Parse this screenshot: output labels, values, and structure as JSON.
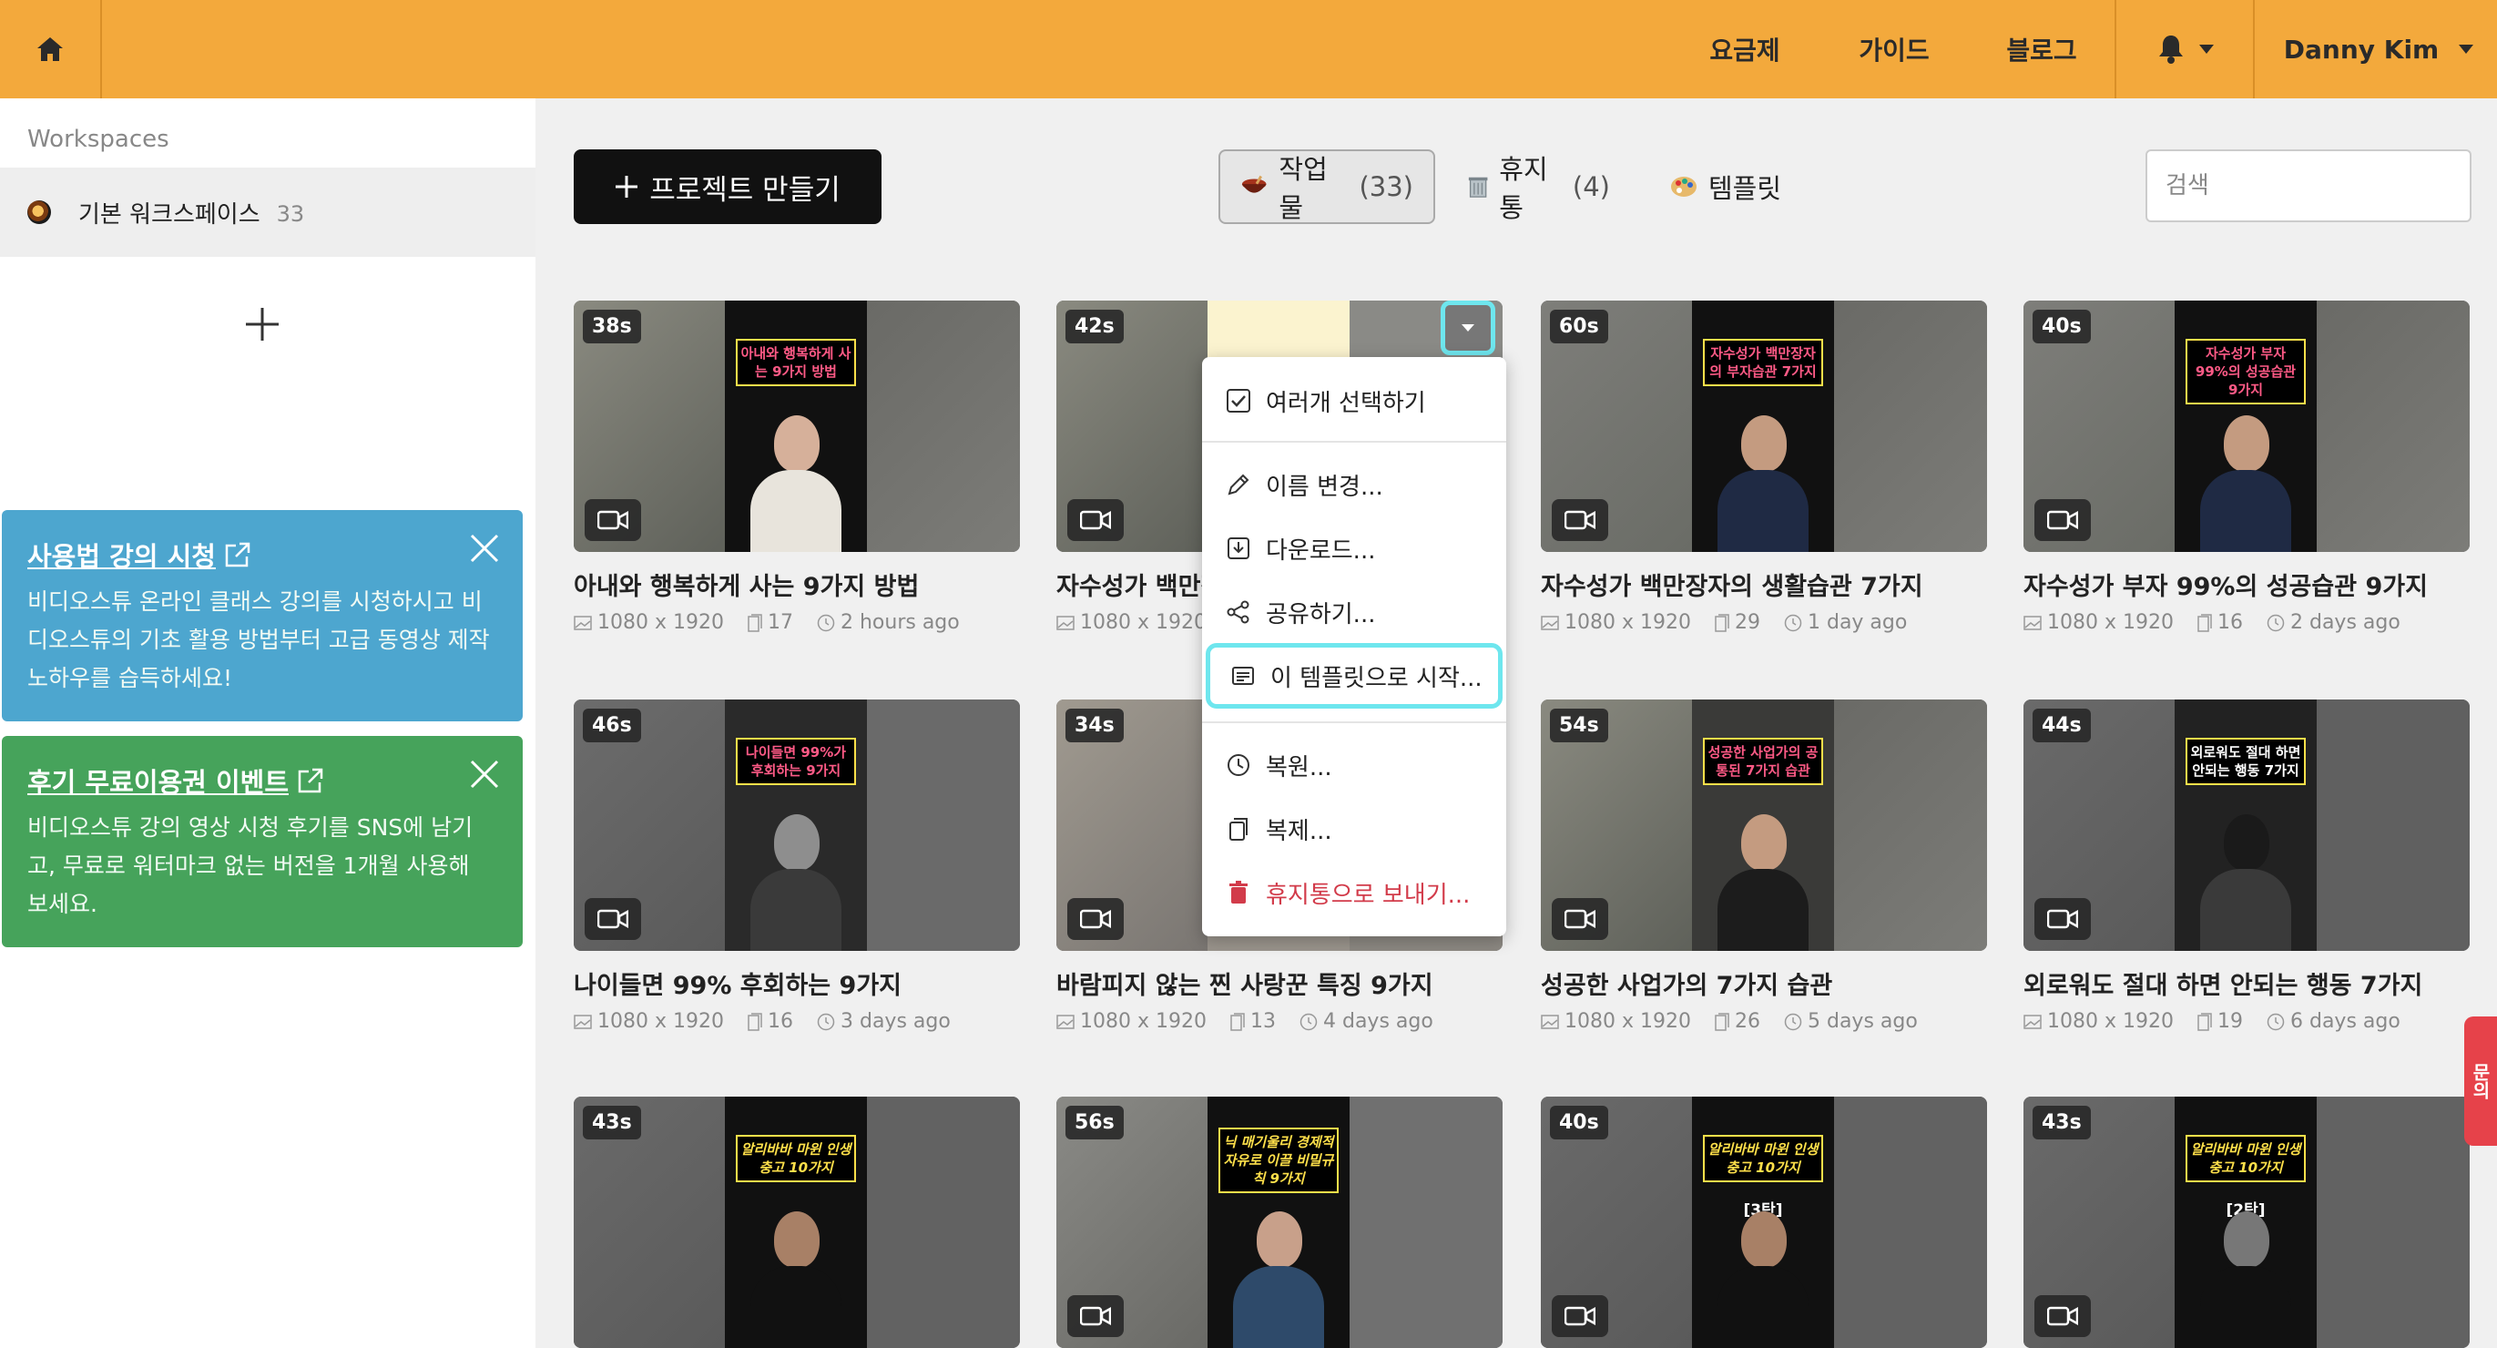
{
  "topbar": {
    "nav": [
      "요금제",
      "가이드",
      "블로그"
    ],
    "user": "Danny Kim"
  },
  "sidebar": {
    "header": "Workspaces",
    "workspace": {
      "name": "기본 워크스페이스",
      "count": "33"
    },
    "promos": [
      {
        "title": "사용법 강의 시청",
        "body": "비디오스튜 온라인 클래스 강의를 시청하시고 비디오스튜의 기초 활용 방법부터 고급 동영상 제작 노하우를 습득하세요!"
      },
      {
        "title": "후기 무료이용권 이벤트",
        "body": "비디오스튜 강의 영상 시청 후기를 SNS에 남기고, 무료로 워터마크 없는 버전을 1개월 사용해 보세요."
      }
    ]
  },
  "toolbar": {
    "create_label": "프로젝트 만들기",
    "tabs": [
      {
        "label": "작업물",
        "count": "(33)"
      },
      {
        "label": "휴지통",
        "count": "(4)"
      },
      {
        "label": "템플릿",
        "count": ""
      }
    ],
    "search_placeholder": "검색"
  },
  "cards": [
    {
      "duration": "38s",
      "title": "아내와 행복하게 사는 9가지 방법",
      "resolution": "1080 x 1920",
      "pages": "17",
      "time": "2 hours ago",
      "poster": "아내와 행복하게 사는 9가지 방법"
    },
    {
      "duration": "42s",
      "title": "자수성가 백만장자의 생활습관",
      "resolution": "1080 x 1920",
      "pages": "",
      "time": "",
      "poster": ""
    },
    {
      "duration": "60s",
      "title": "자수성가 백만장자의 생활습관 7가지",
      "resolution": "1080 x 1920",
      "pages": "29",
      "time": "1 day ago",
      "poster": "자수성가 백만장자의 부자습관 7가지"
    },
    {
      "duration": "40s",
      "title": "자수성가 부자 99%의 성공습관 9가지",
      "resolution": "1080 x 1920",
      "pages": "16",
      "time": "2 days ago",
      "poster": "자수성가 부자 99%의 성공습관 9가지"
    },
    {
      "duration": "46s",
      "title": "나이들면 99% 후회하는 9가지",
      "resolution": "1080 x 1920",
      "pages": "16",
      "time": "3 days ago",
      "poster": "나이들면 99%가 후회하는 9가지"
    },
    {
      "duration": "34s",
      "title": "바람피지 않는 찐 사랑꾼 특징 9가지",
      "resolution": "1080 x 1920",
      "pages": "13",
      "time": "4 days ago",
      "poster": ""
    },
    {
      "duration": "54s",
      "title": "성공한 사업가의 7가지 습관",
      "resolution": "1080 x 1920",
      "pages": "26",
      "time": "5 days ago",
      "poster": "성공한 사업가의 공통된 7가지 습관"
    },
    {
      "duration": "44s",
      "title": "외로워도 절대 하면 안되는 행동 7가지",
      "resolution": "1080 x 1920",
      "pages": "19",
      "time": "6 days ago",
      "poster": "외로워도 절대 하면 안되는 행동 7가지"
    },
    {
      "duration": "43s",
      "title": "",
      "resolution": "",
      "pages": "",
      "time": "",
      "poster": "알리바바 마윈 인생충고 10가지"
    },
    {
      "duration": "56s",
      "title": "",
      "resolution": "",
      "pages": "",
      "time": "",
      "poster": "닉 매기울리 경제적자유로 이끌 비밀규칙 9가지"
    },
    {
      "duration": "40s",
      "title": "",
      "resolution": "",
      "pages": "",
      "time": "",
      "poster": "알리바바 마윈 인생충고 10가지",
      "poster_sub": "[3탄]"
    },
    {
      "duration": "43s",
      "title": "",
      "resolution": "",
      "pages": "",
      "time": "",
      "poster": "알리바바 마윈 인생충고 10가지",
      "poster_sub": "[2탄]"
    }
  ],
  "menu": {
    "items": [
      "여러개 선택하기",
      "이름 변경...",
      "다운로드...",
      "공유하기...",
      "이 템플릿으로 시작...",
      "복원...",
      "복제...",
      "휴지통으로 보내기..."
    ]
  },
  "side_tab": "문의",
  "colors": {
    "topbar": "#f3a93c",
    "highlight": "#6ee6ee",
    "danger": "#d23b4a",
    "promo_blue": "#4da6cf",
    "promo_green": "#46a35b"
  }
}
